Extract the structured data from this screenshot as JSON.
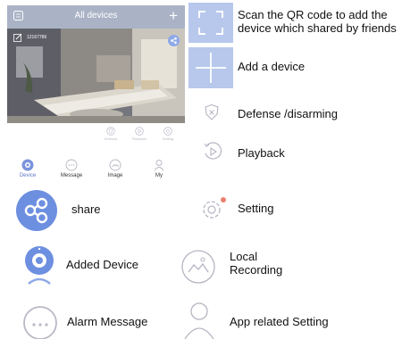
{
  "phone": {
    "header_title": "All devices",
    "device_id": "12167786",
    "small_actions": [
      {
        "label": "Defense",
        "icon": "shield-icon"
      },
      {
        "label": "Playback",
        "icon": "playback-icon"
      },
      {
        "label": "Setting",
        "icon": "gear-icon"
      }
    ],
    "tabs": [
      {
        "label": "Device",
        "icon": "device-icon",
        "active": true
      },
      {
        "label": "Message",
        "icon": "message-icon",
        "active": false
      },
      {
        "label": "Image",
        "icon": "image-icon",
        "active": false
      },
      {
        "label": "My",
        "icon": "person-icon",
        "active": false
      }
    ]
  },
  "legend_left": [
    {
      "label": "share",
      "icon": "share-icon"
    },
    {
      "label": "Added Device",
      "icon": "camera-icon"
    },
    {
      "label": "Alarm Message",
      "icon": "chat-bubble-icon"
    }
  ],
  "legend_right": [
    {
      "label": "Scan the QR code to add the device which shared by friends",
      "icon": "qr-scan-icon"
    },
    {
      "label": "Add a device",
      "icon": "plus-icon"
    },
    {
      "label": "Defense /disarming",
      "icon": "shield-icon"
    },
    {
      "label": "Playback",
      "icon": "playback-icon"
    },
    {
      "label": "Setting",
      "icon": "gear-icon"
    },
    {
      "label": "Local Recording",
      "icon": "image-icon"
    },
    {
      "label": "App related Setting",
      "icon": "person-icon"
    }
  ],
  "colors": {
    "accent": "#5c74c7",
    "header": "#aab3c6",
    "tile": "#b7c8ec",
    "icon_blue": "#6f90e0"
  }
}
